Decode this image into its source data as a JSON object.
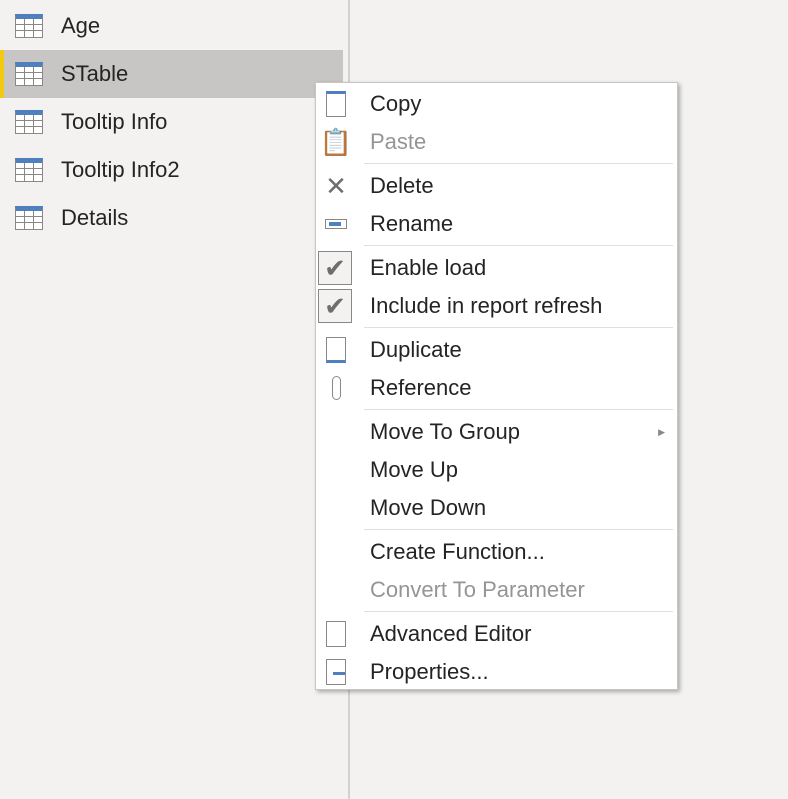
{
  "queries": [
    {
      "label": "Age"
    },
    {
      "label": "STable",
      "selected": true
    },
    {
      "label": "Tooltip Info"
    },
    {
      "label": "Tooltip Info2"
    },
    {
      "label": "Details"
    }
  ],
  "menu": {
    "copy": "Copy",
    "paste": "Paste",
    "delete": "Delete",
    "rename": "Rename",
    "enable_load": "Enable load",
    "include_refresh": "Include in report refresh",
    "duplicate": "Duplicate",
    "reference": "Reference",
    "move_to_group": "Move To Group",
    "move_up": "Move Up",
    "move_down": "Move Down",
    "create_function": "Create Function...",
    "convert_parameter": "Convert To Parameter",
    "advanced_editor": "Advanced Editor",
    "properties": "Properties..."
  },
  "colors": {
    "accent": "#f2c811",
    "selected_bg": "#c8c6c4",
    "icon_blue": "#4f7fbf"
  }
}
